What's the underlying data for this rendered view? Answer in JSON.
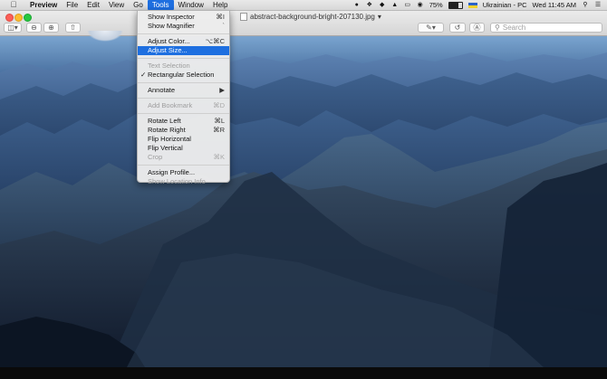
{
  "menubar": {
    "apple_icon": "apple-icon",
    "app_name": "Preview",
    "items": [
      "File",
      "Edit",
      "View",
      "Go",
      "Tools",
      "Window",
      "Help"
    ],
    "active_menu": "Tools",
    "status": {
      "battery_percent": "75%",
      "battery_level": 0.75,
      "input_source": "Ukrainian - PC",
      "datetime": "Wed 11:45 AM"
    }
  },
  "window": {
    "title": "abstract-background-bright-207130.jpg",
    "title_chevron": "▾"
  },
  "toolbar": {
    "sidebar_icon": "sidebar-icon",
    "zoom_out_icon": "zoom-out-icon",
    "zoom_in_icon": "zoom-in-icon",
    "share_icon": "share-icon",
    "markup_icon": "markup-pen-icon",
    "rotate_icon": "rotate-icon",
    "annotate_icon": "annotate-circle-icon",
    "search_placeholder": "Search"
  },
  "tools_menu": {
    "items": [
      {
        "label": "Show Inspector",
        "shortcut": "⌘I",
        "enabled": true
      },
      {
        "label": "Show Magnifier",
        "shortcut": "`",
        "enabled": true
      },
      {
        "label": "Adjust Color...",
        "shortcut": "⌥⌘C",
        "enabled": true
      },
      {
        "label": "Adjust Size...",
        "shortcut": "",
        "enabled": true,
        "highlighted": true
      },
      {
        "label": "Text Selection",
        "shortcut": "",
        "enabled": false
      },
      {
        "label": "Rectangular Selection",
        "shortcut": "",
        "enabled": true,
        "checked": true
      },
      {
        "label": "Annotate",
        "shortcut": "▶",
        "enabled": true
      },
      {
        "label": "Add Bookmark",
        "shortcut": "⌘D",
        "enabled": false
      },
      {
        "label": "Rotate Left",
        "shortcut": "⌘L",
        "enabled": true
      },
      {
        "label": "Rotate Right",
        "shortcut": "⌘R",
        "enabled": true
      },
      {
        "label": "Flip Horizontal",
        "shortcut": "",
        "enabled": true
      },
      {
        "label": "Flip Vertical",
        "shortcut": "",
        "enabled": true
      },
      {
        "label": "Crop",
        "shortcut": "⌘K",
        "enabled": false
      },
      {
        "label": "Assign Profile...",
        "shortcut": "",
        "enabled": true
      },
      {
        "label": "Show Location Info",
        "shortcut": "",
        "enabled": false
      }
    ]
  },
  "colors": {
    "highlight": "#1e6fe0",
    "sky_top": "#7aa4cf",
    "mountain_dark": "#121f33"
  }
}
